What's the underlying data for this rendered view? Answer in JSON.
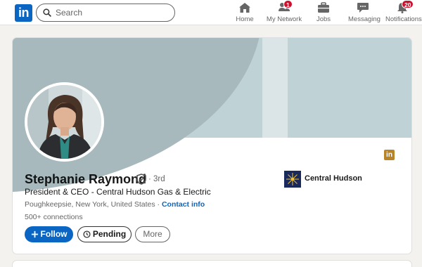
{
  "nav": {
    "logo_text": "in",
    "search_placeholder": "Search",
    "items": [
      {
        "label": "Home",
        "icon": "home-icon",
        "badge": ""
      },
      {
        "label": "My Network",
        "icon": "network-icon",
        "badge": "1"
      },
      {
        "label": "Jobs",
        "icon": "briefcase-icon",
        "badge": ""
      },
      {
        "label": "Messaging",
        "icon": "message-icon",
        "badge": ""
      },
      {
        "label": "Notifications",
        "icon": "bell-icon",
        "badge": "20"
      }
    ]
  },
  "profile": {
    "name": "Stephanie Raymond",
    "degree": "· 3rd",
    "headline": "President & CEO - Central Hudson Gas & Electric",
    "location": "Poughkeepsie, New York, United States",
    "location_separator": " · ",
    "contact_info": "Contact info",
    "connections": "500+ connections",
    "follow_label": "Follow",
    "pending_label": "Pending",
    "more_label": "More",
    "company_name": "Central Hudson"
  },
  "colors": {
    "brand_blue": "#0a66c2",
    "badge_red": "#cb112d",
    "banner_dark": "#a7b9bd",
    "banner_light": "#bfd2d6",
    "premium_gold": "#b7842a"
  }
}
